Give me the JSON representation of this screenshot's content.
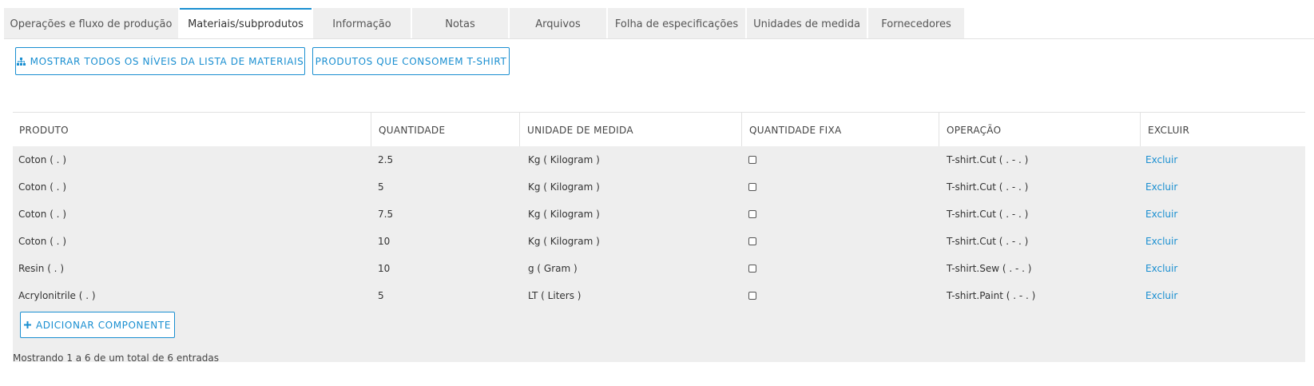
{
  "tabs": [
    {
      "label": "Operações e fluxo de produção",
      "active": false
    },
    {
      "label": "Materiais/subprodutos",
      "active": true
    },
    {
      "label": "Informação",
      "active": false
    },
    {
      "label": "Notas",
      "active": false
    },
    {
      "label": "Arquivos",
      "active": false
    },
    {
      "label": "Folha de especificações",
      "active": false
    },
    {
      "label": "Unidades de medida",
      "active": false
    },
    {
      "label": "Fornecedores",
      "active": false
    }
  ],
  "toolbar": {
    "show_all_levels_label": "MOSTRAR TODOS OS NÍVEIS DA LISTA DE MATERIAIS",
    "show_all_levels_icon": "sitemap-icon",
    "consuming_products_label": "PRODUTOS QUE CONSOMEM T-SHIRT"
  },
  "table": {
    "headers": [
      "PRODUTO",
      "QUANTIDADE",
      "UNIDADE DE MEDIDA",
      "QUANTIDADE FIXA",
      "OPERAÇÃO",
      "EXCLUIR"
    ],
    "rows": [
      {
        "product": "Coton ( . )",
        "quantity": "2.5",
        "unit": "Kg ( Kilogram )",
        "fixed": false,
        "operation": "T-shirt.Cut ( . - . )",
        "delete": "Excluir"
      },
      {
        "product": "Coton ( . )",
        "quantity": "5",
        "unit": "Kg ( Kilogram )",
        "fixed": false,
        "operation": "T-shirt.Cut ( . - . )",
        "delete": "Excluir"
      },
      {
        "product": "Coton ( . )",
        "quantity": "7.5",
        "unit": "Kg ( Kilogram )",
        "fixed": false,
        "operation": "T-shirt.Cut ( . - . )",
        "delete": "Excluir"
      },
      {
        "product": "Coton ( . )",
        "quantity": "10",
        "unit": "Kg ( Kilogram )",
        "fixed": false,
        "operation": "T-shirt.Cut ( . - . )",
        "delete": "Excluir"
      },
      {
        "product": "Resin ( . )",
        "quantity": "10",
        "unit": "g ( Gram )",
        "fixed": false,
        "operation": "T-shirt.Sew ( . - . )",
        "delete": "Excluir"
      },
      {
        "product": "Acrylonitrile ( . )",
        "quantity": "5",
        "unit": "LT ( Liters )",
        "fixed": false,
        "operation": "T-shirt.Paint ( . - . )",
        "delete": "Excluir"
      }
    ],
    "add_component_label": "ADICIONAR COMPONENTE",
    "add_component_icon": "plus-icon"
  },
  "footer": {
    "entries_text": "Mostrando 1 a 6 de um total de 6 entradas"
  },
  "colors": {
    "accent": "#1a8fd1",
    "row_background": "#eeeeee",
    "tab_background": "#efefef"
  }
}
